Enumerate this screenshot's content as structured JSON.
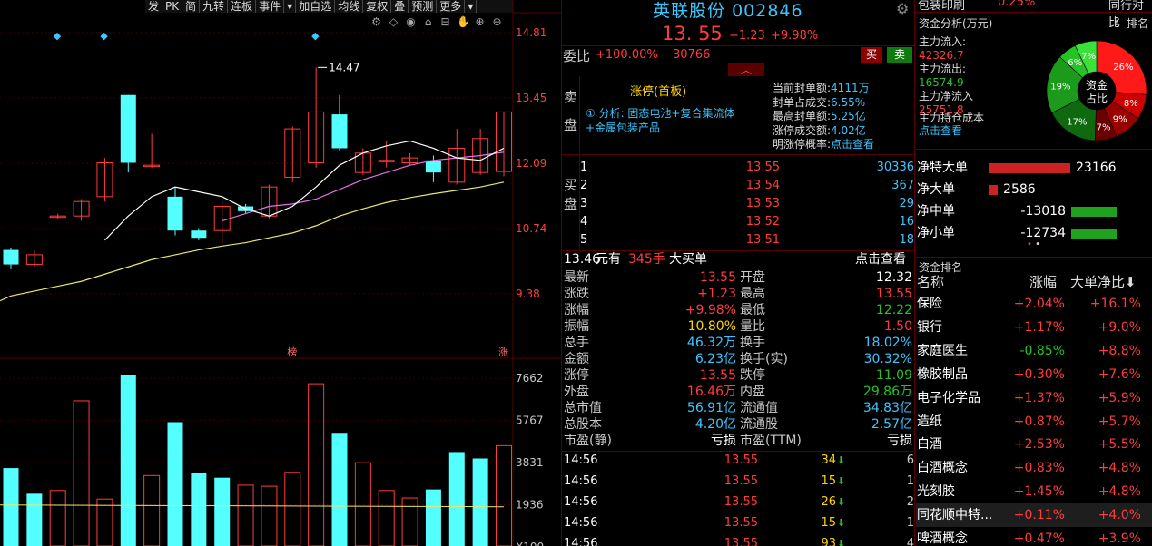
{
  "toolbar": [
    "发",
    "PK",
    "简",
    "九转",
    "连板",
    "事件",
    "▾",
    "加自选",
    "均线",
    "复权",
    "叠",
    "预测",
    "更多",
    "▾"
  ],
  "chart_icons": [
    "⚙",
    "◇",
    "◉",
    "⌂",
    "⊟",
    "✋",
    "⊕",
    "⊖"
  ],
  "chart_data": [
    {
      "type": "candlestick",
      "price_axis": [
        "14.81",
        "13.45",
        "12.09",
        "10.74",
        "9.38"
      ],
      "high_label": "14.47",
      "ylim": [
        8.5,
        15.6
      ],
      "candles": [
        {
          "o": 10.7,
          "c": 10.4,
          "h": 10.75,
          "l": 10.3
        },
        {
          "o": 10.4,
          "c": 10.6,
          "h": 10.7,
          "l": 10.35
        },
        {
          "o": 11.4,
          "c": 11.4,
          "h": 11.45,
          "l": 11.35
        },
        {
          "o": 11.4,
          "c": 11.7,
          "h": 11.75,
          "l": 11.3
        },
        {
          "o": 11.8,
          "c": 12.5,
          "h": 12.6,
          "l": 11.7
        },
        {
          "o": 13.9,
          "c": 12.5,
          "h": 13.9,
          "l": 12.3
        },
        {
          "o": 12.45,
          "c": 12.45,
          "h": 13.1,
          "l": 12.4
        },
        {
          "o": 11.8,
          "c": 11.1,
          "h": 12.0,
          "l": 11.0
        },
        {
          "o": 11.1,
          "c": 10.95,
          "h": 11.15,
          "l": 10.9
        },
        {
          "o": 11.1,
          "c": 11.6,
          "h": 11.7,
          "l": 10.85
        },
        {
          "o": 11.6,
          "c": 11.5,
          "h": 11.65,
          "l": 11.45
        },
        {
          "o": 11.4,
          "c": 12.0,
          "h": 12.05,
          "l": 11.35
        },
        {
          "o": 12.2,
          "c": 13.2,
          "h": 13.25,
          "l": 12.1
        },
        {
          "o": 12.5,
          "c": 13.55,
          "h": 14.47,
          "l": 12.4
        },
        {
          "o": 13.5,
          "c": 12.8,
          "h": 13.9,
          "l": 12.75
        },
        {
          "o": 12.3,
          "c": 12.7,
          "h": 12.8,
          "l": 12.25
        },
        {
          "o": 12.55,
          "c": 12.55,
          "h": 12.95,
          "l": 12.4
        },
        {
          "o": 12.5,
          "c": 12.6,
          "h": 12.7,
          "l": 12.45
        },
        {
          "o": 12.55,
          "c": 12.3,
          "h": 12.65,
          "l": 12.1
        },
        {
          "o": 12.1,
          "c": 12.8,
          "h": 13.2,
          "l": 12.05
        },
        {
          "o": 12.3,
          "c": 13.0,
          "h": 13.2,
          "l": 12.25
        },
        {
          "o": 12.32,
          "c": 13.55,
          "h": 13.55,
          "l": 12.22
        }
      ],
      "ma_white": [
        null,
        null,
        null,
        null,
        10.9,
        11.4,
        11.8,
        12.0,
        11.9,
        11.8,
        11.55,
        11.4,
        11.6,
        12.0,
        12.45,
        12.7,
        12.85,
        12.95,
        12.8,
        12.6,
        12.55,
        12.8
      ],
      "ma_magenta": [
        null,
        null,
        null,
        null,
        null,
        null,
        null,
        null,
        null,
        11.3,
        11.45,
        11.6,
        11.65,
        11.75,
        11.95,
        12.15,
        12.3,
        12.45,
        12.55,
        12.6,
        12.65,
        12.72
      ],
      "ma_yellow": [
        9.75,
        9.85,
        9.95,
        10.05,
        10.2,
        10.35,
        10.5,
        10.6,
        10.7,
        10.78,
        10.85,
        10.95,
        11.05,
        11.2,
        11.4,
        11.55,
        11.68,
        11.78,
        11.86,
        11.93,
        12.0,
        12.1
      ],
      "markers": [
        "◆",
        "◆",
        "◆"
      ],
      "marker_candles": [
        2,
        4,
        13
      ],
      "bottom_markers": [
        {
          "candle": 12,
          "text": "榜"
        },
        {
          "candle": 21,
          "text": "涨"
        }
      ]
    },
    {
      "type": "bar",
      "volume_axis": [
        "7662",
        "5767",
        "3831",
        "1936",
        "X100"
      ],
      "ylim": [
        0,
        8200
      ],
      "values": [
        3650,
        2450,
        2600,
        6800,
        2200,
        8000,
        3300,
        5800,
        3400,
        3200,
        2850,
        2800,
        3450,
        7600,
        5300,
        3900,
        2600,
        2250,
        2650,
        4400,
        4100,
        4700
      ],
      "up": [
        false,
        false,
        true,
        true,
        true,
        false,
        true,
        false,
        false,
        false,
        true,
        true,
        true,
        true,
        false,
        true,
        true,
        true,
        false,
        false,
        false,
        true
      ],
      "ma_level": 1920
    }
  ],
  "mid": {
    "stock_name": "英联股份",
    "stock_code": "002846",
    "price": "13. 55",
    "change": "+1.23",
    "change_pct": "+9.98%",
    "webi_label": "委比",
    "webi_value": "+100.00%",
    "webi_diff": "30766",
    "buy_btn": "买",
    "sell_btn": "卖",
    "sell_side_label": "卖盘",
    "buy_side_label": "买盘",
    "limit_up": "涨停(首板)",
    "analysis": "① 分析: 固态电池+复合集流体",
    "analysis2": "+金属包装产品",
    "seal_info": [
      {
        "k": "当前封单额:",
        "v": "4111万"
      },
      {
        "k": "封单占成交:",
        "v": "6.55%"
      },
      {
        "k": "最高封单额:",
        "v": "5.25亿"
      },
      {
        "k": "涨停成交额:",
        "v": "4.02亿"
      },
      {
        "k": "明涨停概率:",
        "v": "点击查看"
      }
    ],
    "bids": [
      {
        "lv": "1",
        "p": "13.55",
        "q": "30336"
      },
      {
        "lv": "2",
        "p": "13.54",
        "q": "367"
      },
      {
        "lv": "3",
        "p": "13.53",
        "q": "29"
      },
      {
        "lv": "4",
        "p": "13.52",
        "q": "16"
      },
      {
        "lv": "5",
        "p": "13.51",
        "q": "18"
      }
    ],
    "bigbuy": {
      "price": "13.46",
      "unit1": "元有",
      "hands": "345手",
      "label": "大买单",
      "link": "点击查看"
    },
    "stats": [
      {
        "k1": "最新",
        "v1": "13.55",
        "c1": "red",
        "k2": "开盘",
        "v2": "12.32",
        "c2": "white"
      },
      {
        "k1": "涨跌",
        "v1": "+1.23",
        "c1": "red",
        "k2": "最高",
        "v2": "13.55",
        "c2": "red"
      },
      {
        "k1": "涨幅",
        "v1": "+9.98%",
        "c1": "red",
        "k2": "最低",
        "v2": "12.22",
        "c2": "green"
      },
      {
        "k1": "振幅",
        "v1": "10.80%",
        "c1": "yellow",
        "k2": "量比",
        "v2": "1.50",
        "c2": "red"
      },
      {
        "k1": "总手",
        "v1": "46.32万",
        "c1": "cyan",
        "k2": "换手",
        "v2": "18.02%",
        "c2": "cyan"
      },
      {
        "k1": "金额",
        "v1": "6.23亿",
        "c1": "cyan",
        "k2": "换手(实)",
        "v2": "30.32%",
        "c2": "cyan"
      },
      {
        "k1": "涨停",
        "v1": "13.55",
        "c1": "red",
        "k2": "跌停",
        "v2": "11.09",
        "c2": "green"
      },
      {
        "k1": "外盘",
        "v1": "16.46万",
        "c1": "red",
        "k2": "内盘",
        "v2": "29.86万",
        "c2": "green"
      },
      {
        "k1": "总市值",
        "v1": "56.91亿",
        "c1": "cyan",
        "k2": "流通值",
        "v2": "34.83亿",
        "c2": "cyan"
      },
      {
        "k1": "总股本",
        "v1": "4.20亿",
        "c1": "cyan",
        "k2": "流通股",
        "v2": "2.57亿",
        "c2": "cyan"
      },
      {
        "k1": "市盈(静)",
        "v1": "亏损",
        "c1": "white",
        "k2": "市盈(TTM)",
        "v2": "亏损",
        "c2": "white"
      }
    ],
    "ticks": [
      {
        "t": "14:56",
        "p": "13.55",
        "v": "34",
        "c": "6"
      },
      {
        "t": "14:56",
        "p": "13.55",
        "v": "15",
        "c": "1"
      },
      {
        "t": "14:56",
        "p": "13.55",
        "v": "26",
        "c": "2"
      },
      {
        "t": "14:56",
        "p": "13.55",
        "v": "15",
        "c": "1"
      },
      {
        "t": "14:56",
        "p": "13.55",
        "v": "93",
        "c": "4"
      }
    ]
  },
  "right": {
    "top_sector": "包装印刷",
    "top_pct": "0.25%",
    "top_right": "同行对比",
    "fund_title": "资金分析(万元)",
    "help": "?",
    "rank_link": "排名",
    "flows": [
      {
        "k": "主力流入:",
        "v": "42326.7",
        "color": "#ff3c3c"
      },
      {
        "k": "主力流出:",
        "v": "16574.9",
        "color": "#24c224"
      },
      {
        "k": "主力净流入",
        "v": "25751.8",
        "color": "#ff3c3c"
      },
      {
        "k": "主力持仓成本",
        "v": "点击查看",
        "color": "#3cc6ff"
      }
    ],
    "pie": {
      "center1": "资金",
      "center2": "占比",
      "slices": [
        {
          "label": "26%",
          "value": 26,
          "color": "#ff1a1a"
        },
        {
          "label": "8%",
          "value": 8,
          "color": "#cc0000"
        },
        {
          "label": "9%",
          "value": 9,
          "color": "#990000"
        },
        {
          "label": "7%",
          "value": 7,
          "color": "#6a0000"
        },
        {
          "label": "17%",
          "value": 17,
          "color": "#0f6a0f"
        },
        {
          "label": "19%",
          "value": 19,
          "color": "#1b9a1b"
        },
        {
          "label": "6%",
          "value": 6,
          "color": "#24c224"
        },
        {
          "label": "7%",
          "value": 7,
          "color": "#3be03b"
        }
      ]
    },
    "net": [
      {
        "name": "净特大单",
        "val": "23166",
        "n": 23166,
        "color": "#cc2222"
      },
      {
        "name": "净大单",
        "val": "2586",
        "n": 2586,
        "color": "#cc2222"
      },
      {
        "name": "净中单",
        "val": "-13018",
        "n": -13018,
        "color": "#1fa31f"
      },
      {
        "name": "净小单",
        "val": "-12734",
        "n": -12734,
        "color": "#1fa31f"
      }
    ],
    "dots": "• •",
    "rank_title": "资金排名",
    "rank_headers": [
      "名称",
      "涨幅",
      "大单净比⬇"
    ],
    "rank": [
      {
        "name": "保险",
        "pct": "+2.04%",
        "net": "+16.1%"
      },
      {
        "name": "银行",
        "pct": "+1.17%",
        "net": "+9.0%"
      },
      {
        "name": "家庭医生",
        "pct": "-0.85%",
        "net": "+8.8%"
      },
      {
        "name": "橡胶制品",
        "pct": "+0.30%",
        "net": "+7.6%"
      },
      {
        "name": "电子化学品",
        "pct": "+1.37%",
        "net": "+5.9%"
      },
      {
        "name": "造纸",
        "pct": "+0.87%",
        "net": "+5.7%"
      },
      {
        "name": "白酒",
        "pct": "+2.53%",
        "net": "+5.5%"
      },
      {
        "name": "白酒概念",
        "pct": "+0.83%",
        "net": "+4.8%"
      },
      {
        "name": "光刻胶",
        "pct": "+1.45%",
        "net": "+4.8%"
      },
      {
        "name": "同花顺中特...",
        "pct": "+0.11%",
        "net": "+4.0%"
      },
      {
        "name": "啤酒概念",
        "pct": "+0.47%",
        "net": "+3.9%"
      }
    ]
  }
}
